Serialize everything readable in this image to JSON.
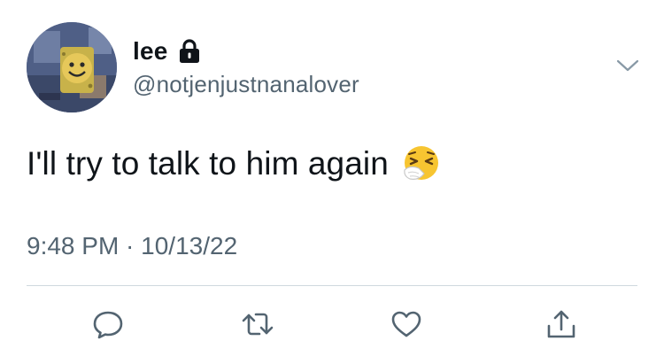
{
  "tweet": {
    "display_name": "lee",
    "protected": true,
    "handle": "@notjenjustnanalover",
    "text": "I'll try to talk to him again",
    "emoji": "sneezing-face",
    "timestamp": "9:48 PM · 10/13/22"
  },
  "icons": {
    "lock": "lock-icon",
    "caret": "chevron-down-icon",
    "reply": "reply-icon",
    "retweet": "retweet-icon",
    "like": "heart-icon",
    "share": "share-icon"
  },
  "colors": {
    "text_primary": "#0f1419",
    "text_secondary": "#536471",
    "icon": "#536471",
    "divider": "#cfd9de"
  }
}
